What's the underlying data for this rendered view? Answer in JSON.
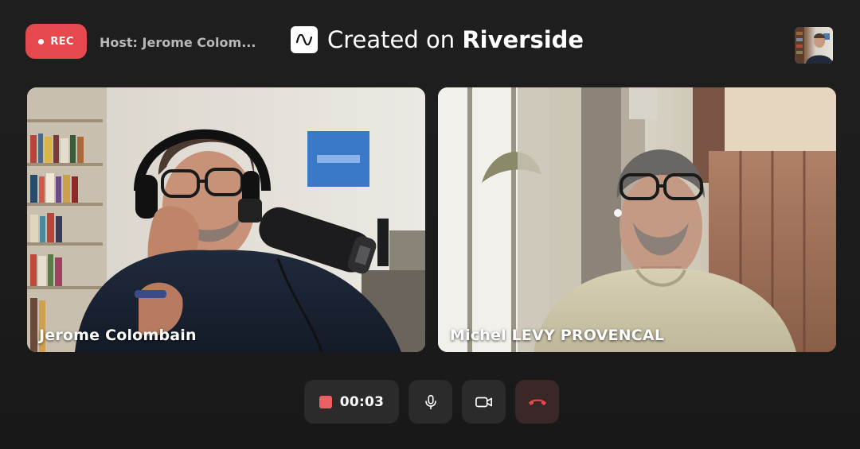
{
  "header": {
    "rec_label": "REC",
    "host_label": "Host: Jerome Colom...",
    "brand_prefix": "Created on",
    "brand_name": "Riverside"
  },
  "participants": [
    {
      "name": "Jerome Colombain"
    },
    {
      "name": "Michel LEVY PROVENCAL"
    }
  ],
  "controls": {
    "timer": "00:03",
    "mic_icon": "microphone-icon",
    "camera_icon": "video-camera-icon",
    "leave_icon": "phone-hangup-icon"
  },
  "colors": {
    "rec": "#e5484d",
    "stop": "#ee5f64",
    "leave": "#e5484d",
    "control_bg": "#2b2b2b",
    "background": "#1e1e1e"
  }
}
